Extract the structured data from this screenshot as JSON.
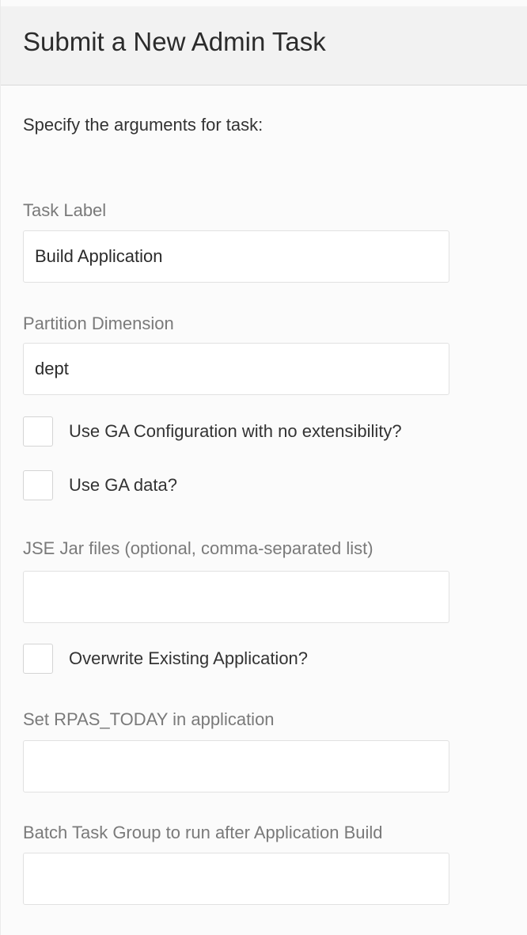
{
  "header": {
    "title": "Submit a New Admin Task"
  },
  "intro": "Specify the arguments for task:",
  "fields": {
    "task_label": {
      "label": "Task Label",
      "value": "Build Application"
    },
    "partition_dimension": {
      "label": "Partition Dimension",
      "value": "dept"
    },
    "jse_jar_files": {
      "label": "JSE Jar files (optional, comma-separated list)",
      "value": ""
    },
    "rpas_today": {
      "label": "Set RPAS_TODAY in application",
      "value": ""
    },
    "batch_task_group": {
      "label": "Batch Task Group to run after Application Build",
      "value": ""
    }
  },
  "checkboxes": {
    "ga_configuration": {
      "label": "Use GA Configuration with no extensibility?",
      "checked": false
    },
    "ga_data": {
      "label": "Use GA data?",
      "checked": false
    },
    "overwrite_existing": {
      "label": "Overwrite Existing Application?",
      "checked": false
    }
  }
}
